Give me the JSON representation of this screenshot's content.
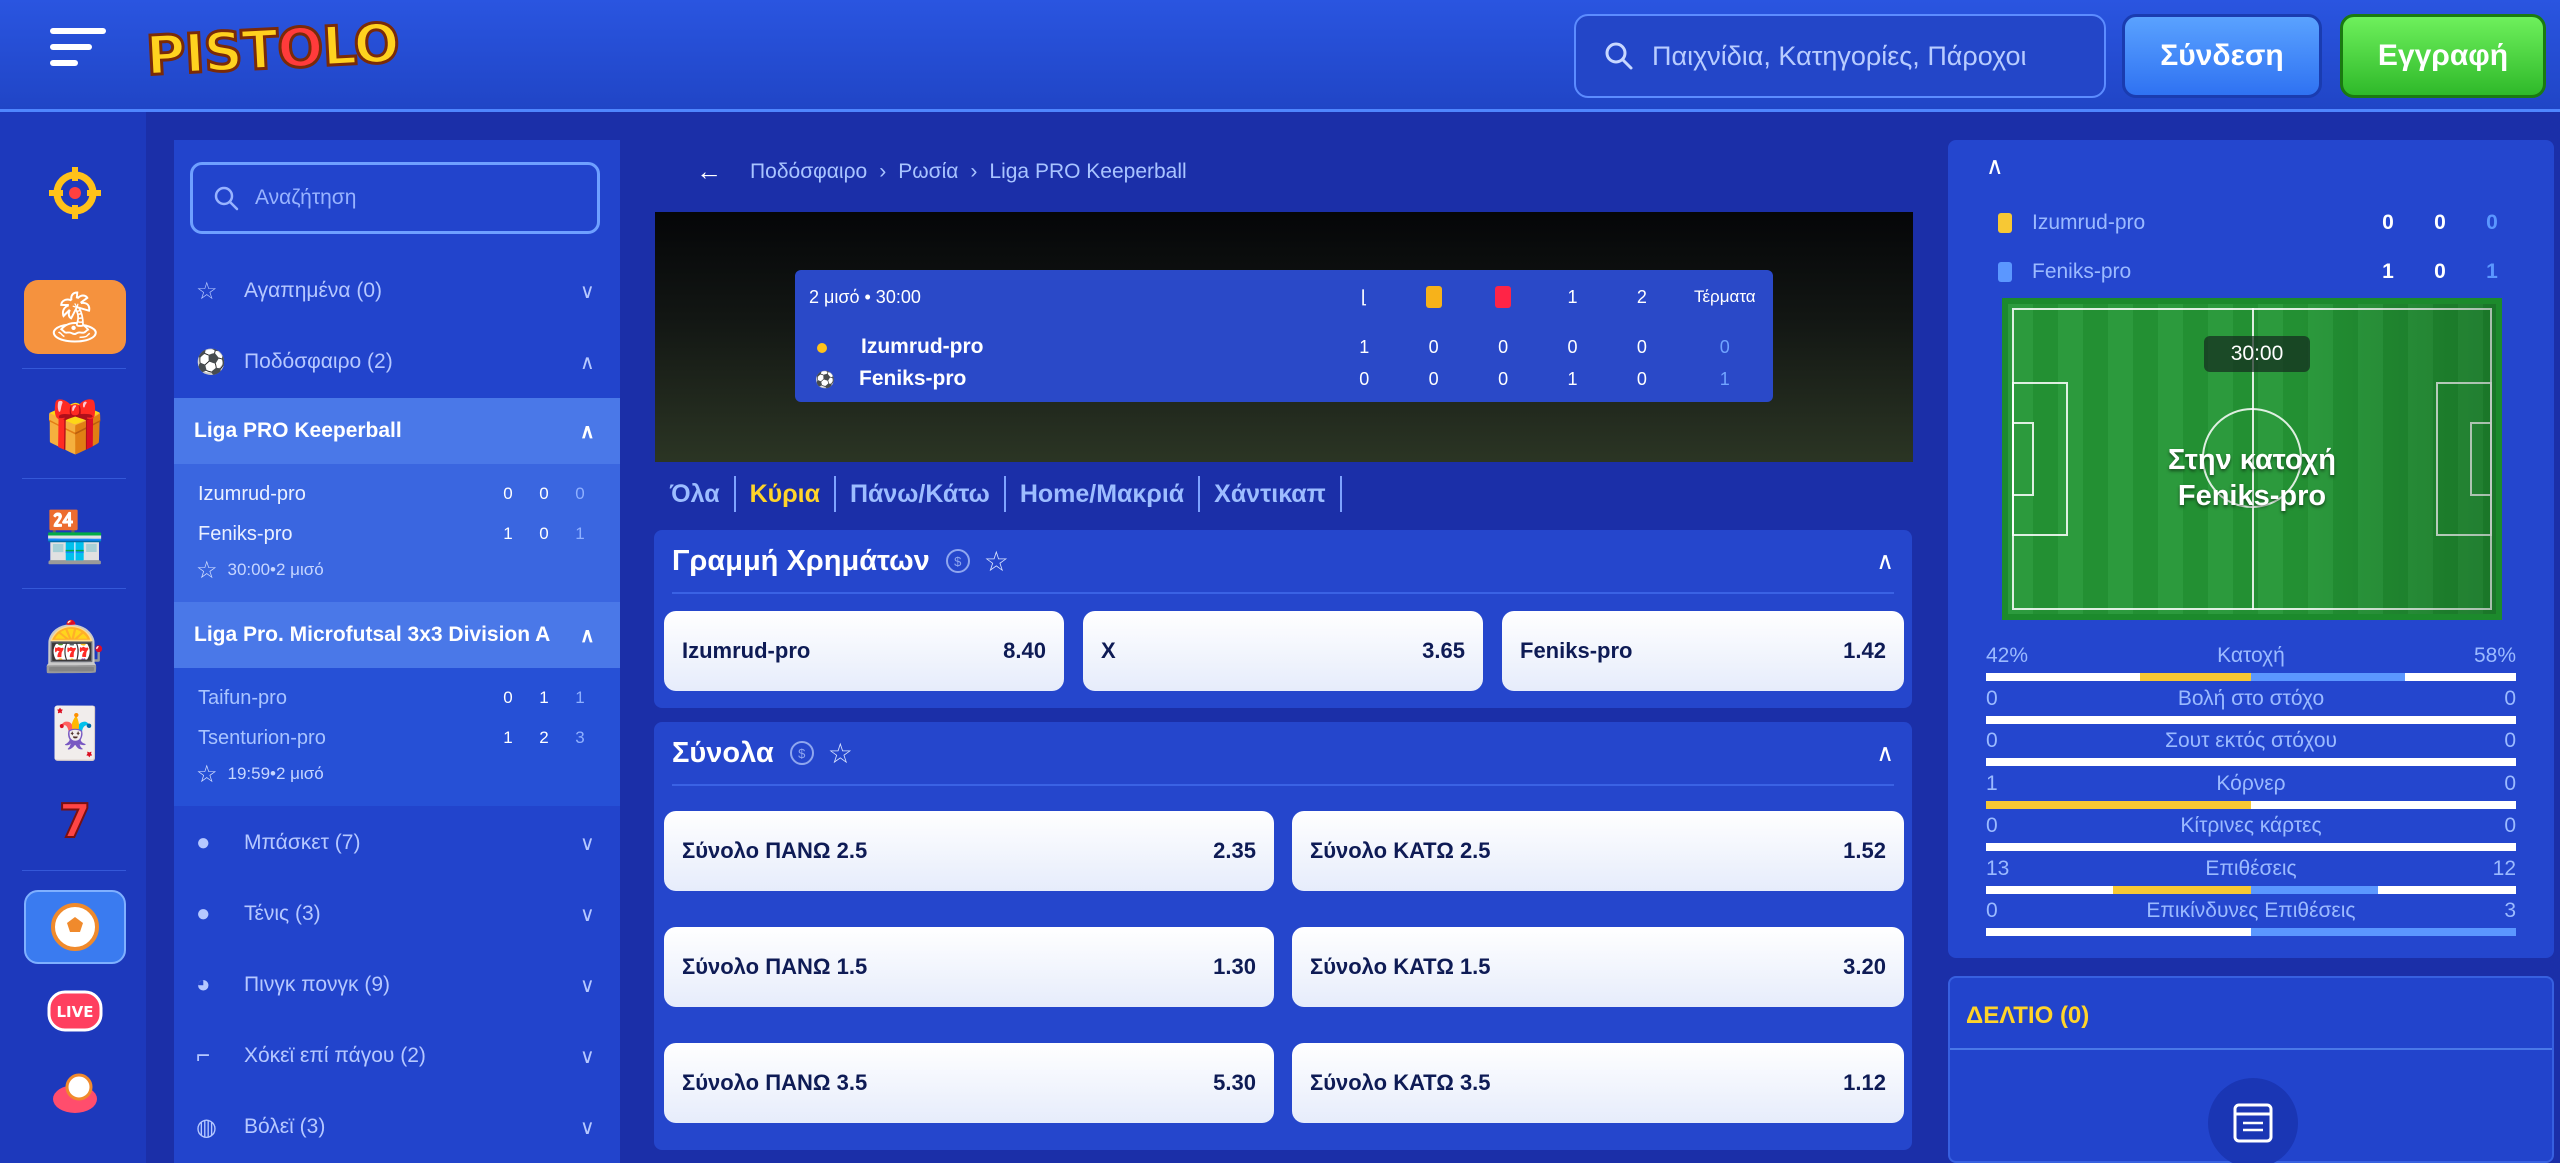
{
  "header": {
    "logo": "PISTOLO",
    "search_placeholder": "Παιχνίδια, Κατηγορίες, Πάροχοι",
    "login_label": "Σύνδεση",
    "register_label": "Εγγραφή"
  },
  "rail": {
    "icons": [
      "crosshair-icon",
      "palm-island-icon",
      "gift-icon",
      "shop-icon",
      "slot-machine-icon",
      "cards-icon",
      "lucky-seven-icon",
      "football-icon",
      "live-icon",
      "bet-icon"
    ]
  },
  "sports": {
    "search_placeholder": "Αναζήτηση",
    "favorites": "Αγαπημένα (0)",
    "football": "Ποδόσφαιρο (2)",
    "leagues": [
      {
        "name": "Liga PRO Keeperball",
        "teams": [
          {
            "name": "Izumrud-pro",
            "s1": "0",
            "s2": "0",
            "s3": "0"
          },
          {
            "name": "Feniks-pro",
            "s1": "1",
            "s2": "0",
            "s3": "1"
          }
        ],
        "time": "30:00•2 μισό"
      },
      {
        "name": "Liga Pro. Microfutsal 3x3 Division A",
        "teams": [
          {
            "name": "Taifun-pro",
            "s1": "0",
            "s2": "1",
            "s3": "1"
          },
          {
            "name": "Tsenturion-pro",
            "s1": "1",
            "s2": "2",
            "s3": "3"
          }
        ],
        "time": "19:59•2 μισό"
      }
    ],
    "others": [
      "Μπάσκετ (7)",
      "Τένις (3)",
      "Πινγκ πονγκ (9)",
      "Χόκεϊ επί πάγου (2)",
      "Βόλεϊ (3)"
    ]
  },
  "breadcrumb": [
    "Ποδόσφαιρο",
    "Ρωσία",
    "Liga PRO Keeperball"
  ],
  "scoreboard": {
    "period": "2 μισό • 30:00",
    "col1": "1",
    "col2": "2",
    "goals_label": "Τέρματα",
    "teams": [
      {
        "name": "Izumrud-pro",
        "corners": "1",
        "yellow": "0",
        "red": "0",
        "h1": "0",
        "h2": "0",
        "goals": "0"
      },
      {
        "name": "Feniks-pro",
        "corners": "0",
        "yellow": "0",
        "red": "0",
        "h1": "1",
        "h2": "0",
        "goals": "1"
      }
    ]
  },
  "tabs": [
    "Όλα",
    "Κύρια",
    "Πάνω/Κάτω",
    "Home/Μακριά",
    "Χάντικαπ"
  ],
  "moneyline": {
    "title": "Γραμμή Χρημάτων",
    "coin": "$",
    "odds": [
      {
        "name": "Izumrud-pro",
        "value": "8.40"
      },
      {
        "name": "X",
        "value": "3.65"
      },
      {
        "name": "Feniks-pro",
        "value": "1.42"
      }
    ]
  },
  "totals": {
    "title": "Σύνολα",
    "coin": "$",
    "odds": [
      {
        "name": "Σύνολο ΠΑΝΩ 2.5",
        "value": "2.35"
      },
      {
        "name": "Σύνολο ΚΑΤΩ 2.5",
        "value": "1.52"
      },
      {
        "name": "Σύνολο ΠΑΝΩ 1.5",
        "value": "1.30"
      },
      {
        "name": "Σύνολο ΚΑΤΩ 1.5",
        "value": "3.20"
      },
      {
        "name": "Σύνολο ΠΑΝΩ 3.5",
        "value": "5.30"
      },
      {
        "name": "Σύνολο ΚΑΤΩ 3.5",
        "value": "1.12"
      }
    ]
  },
  "stats": {
    "teams": [
      {
        "name": "Izumrud-pro",
        "a": "0",
        "b": "0",
        "c": "0",
        "card_color": "#f7c834"
      },
      {
        "name": "Feniks-pro",
        "a": "1",
        "b": "0",
        "c": "1",
        "card_color": "#5b97ff"
      }
    ],
    "timer": "30:00",
    "possession_line1": "Στην κατοχή",
    "possession_line2": "Feniks-pro",
    "rows": [
      {
        "left": "42%",
        "label": "Κατοχή",
        "right": "58%",
        "left_frac": 0.42,
        "right_frac": 0.58
      },
      {
        "left": "0",
        "label": "Βολή στο στόχο",
        "right": "0",
        "left_frac": 0,
        "right_frac": 0
      },
      {
        "left": "0",
        "label": "Σουτ εκτός στόχου",
        "right": "0",
        "left_frac": 0,
        "right_frac": 0
      },
      {
        "left": "1",
        "label": "Κόρνερ",
        "right": "0",
        "left_frac": 1,
        "right_frac": 0
      },
      {
        "left": "0",
        "label": "Κίτρινες κάρτες",
        "right": "0",
        "left_frac": 0,
        "right_frac": 0
      },
      {
        "left": "13",
        "label": "Επιθέσεις",
        "right": "12",
        "left_frac": 0.52,
        "right_frac": 0.48
      },
      {
        "left": "0",
        "label": "Επικίνδυνες Επιθέσεις",
        "right": "3",
        "left_frac": 0,
        "right_frac": 1
      }
    ]
  },
  "coupon": {
    "title": "ΔΕΛΤΙΟ (0)"
  },
  "colors": {
    "accent_yellow": "#ffd42a",
    "home_color": "#f7c834",
    "away_color": "#5b97ff",
    "register_green": "#2fb92a"
  }
}
